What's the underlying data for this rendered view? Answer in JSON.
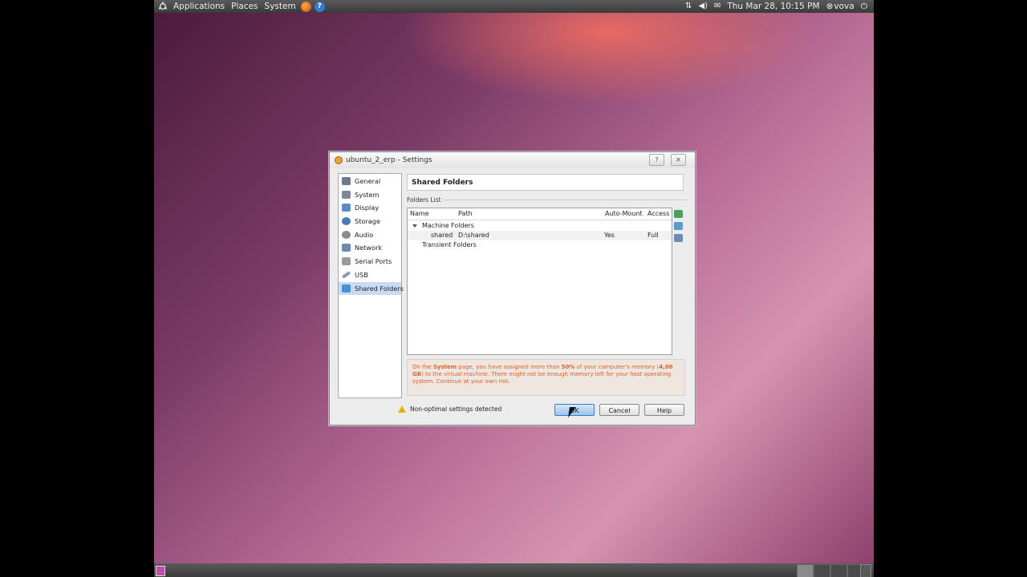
{
  "topbar": {
    "menus": [
      "Applications",
      "Places",
      "System"
    ],
    "clock": "Thu Mar 28, 10:15 PM",
    "user": "vova"
  },
  "dialog": {
    "title": "ubuntu_2_erp - Settings",
    "title_help": "?",
    "title_close": "✕",
    "nav_items": [
      "General",
      "System",
      "Display",
      "Storage",
      "Audio",
      "Network",
      "Serial Ports",
      "USB",
      "Shared Folders"
    ],
    "selected_nav": "Shared Folders",
    "page_title": "Shared Folders",
    "group_label": "Folders List",
    "columns": [
      "Name",
      "Path",
      "Auto-Mount",
      "Access"
    ],
    "groups": {
      "machine": "Machine Folders",
      "transient": "Transient Folders"
    },
    "share": {
      "name": "shared",
      "path": "D:\\shared",
      "auto_mount": "Yes",
      "access": "Full"
    },
    "warning": {
      "p1": "On the ",
      "p2": "System",
      "p3": " page, you have assigned more than ",
      "p4": "50%",
      "p5": " of your computer's memory (",
      "p6": "4,00 GB",
      "p7": ") to the virtual machine. There might not be enough memory left for your host operating system. Continue at your own risk."
    },
    "footer_warning": "Non-optimal settings detected",
    "buttons": {
      "ok": "OK",
      "cancel": "Cancel",
      "help": "Help"
    }
  },
  "colors": {
    "warning_text": "#d8642a",
    "selection": "#c7dcf2",
    "default_button": "#9cc4ec"
  }
}
